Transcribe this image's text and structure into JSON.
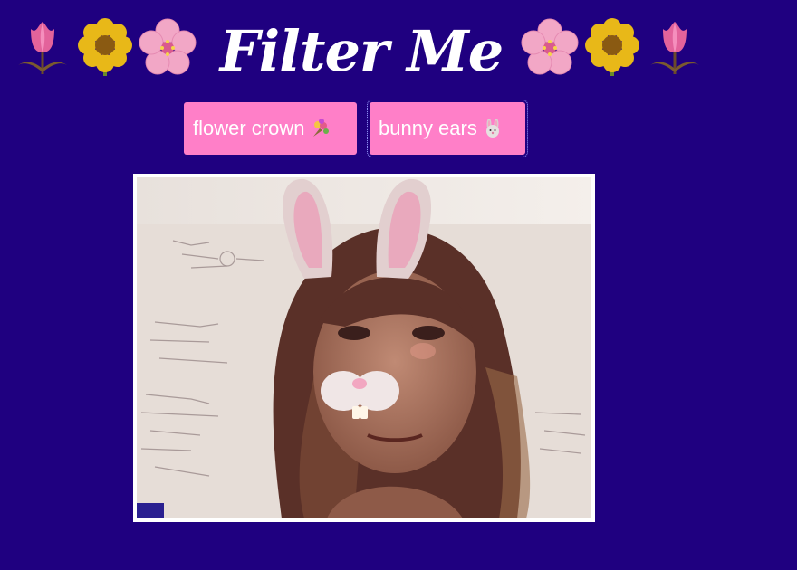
{
  "header": {
    "title": "Filter Me",
    "decorations": [
      "tulip-icon",
      "sunflower-icon",
      "cherry-blossom-icon",
      "cherry-blossom-icon",
      "sunflower-icon",
      "tulip-icon"
    ]
  },
  "filters": [
    {
      "label": "flower crown",
      "icon": "bouquet-icon",
      "selected": false
    },
    {
      "label": "bunny ears",
      "icon": "rabbit-icon",
      "selected": true
    }
  ],
  "video": {
    "active_filter": "bunny ears"
  },
  "colors": {
    "background": "#1f0080",
    "button": "#ff7fc8",
    "title": "#ffffff"
  }
}
